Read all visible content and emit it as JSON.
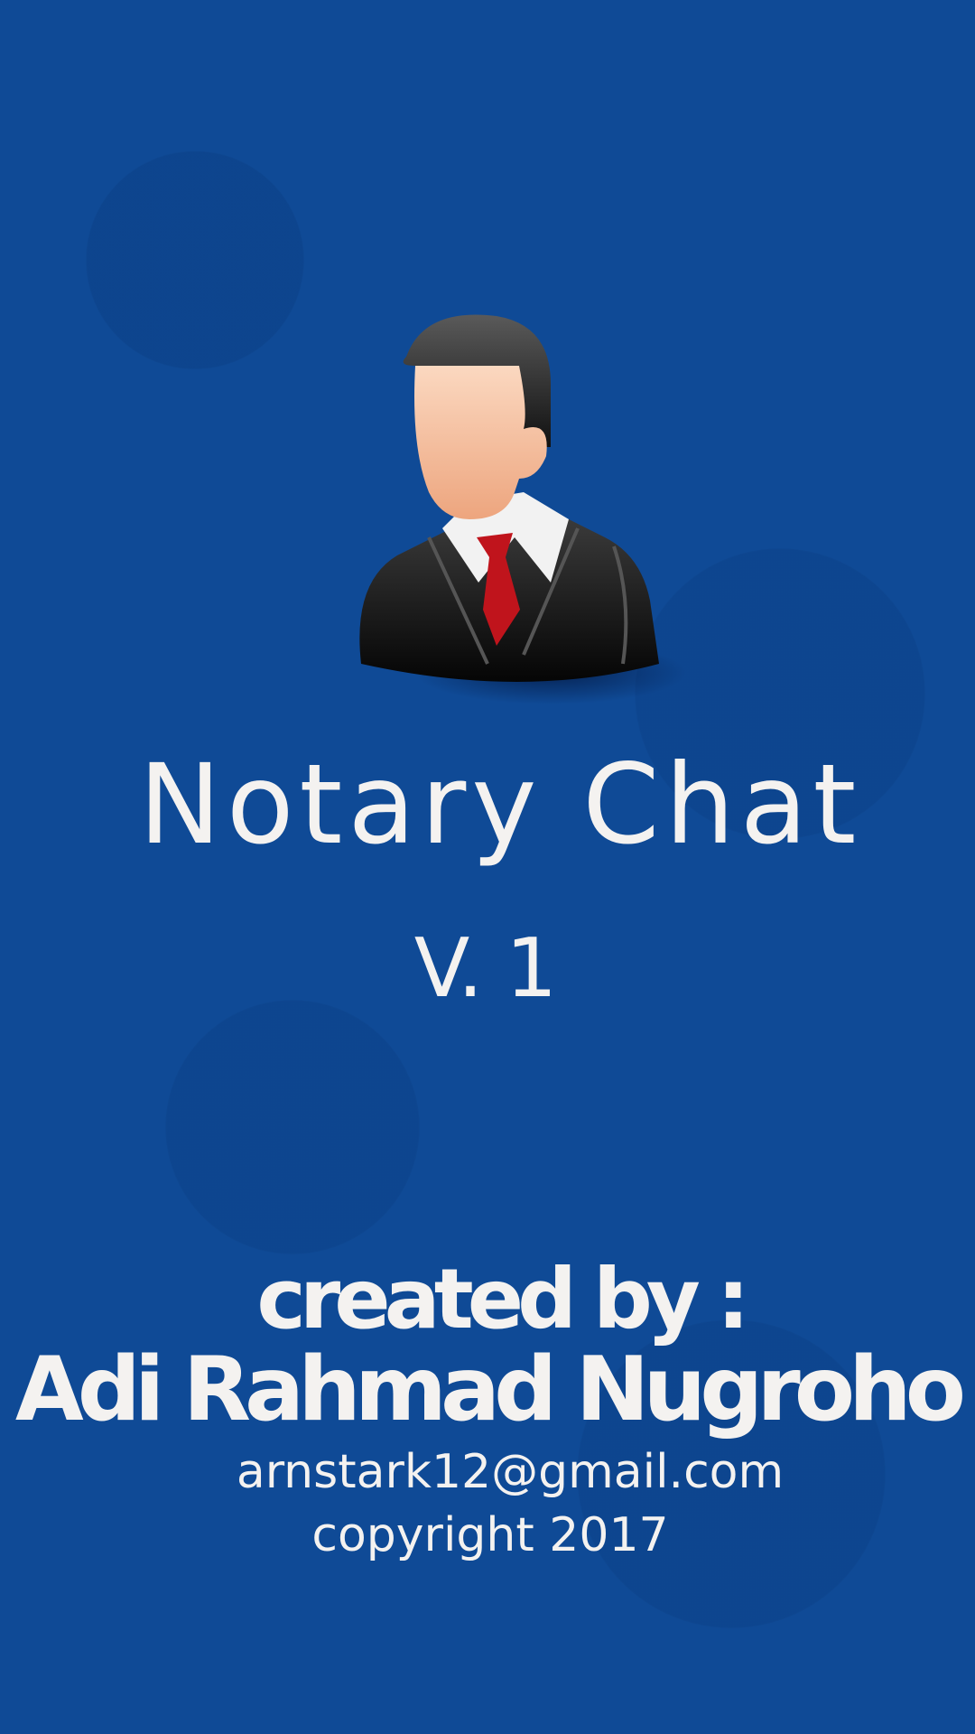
{
  "app": {
    "title": "Notary Chat",
    "version": "V. 1",
    "credits_label": "created by :",
    "author": "Adi Rahmad Nugroho",
    "email": "arnstark12@gmail.com",
    "copyright": "copyright 2017"
  },
  "colors": {
    "background": "#0f4a96",
    "text": "#f4f2f0"
  },
  "icons": {
    "logo": "businessman-avatar-icon"
  }
}
